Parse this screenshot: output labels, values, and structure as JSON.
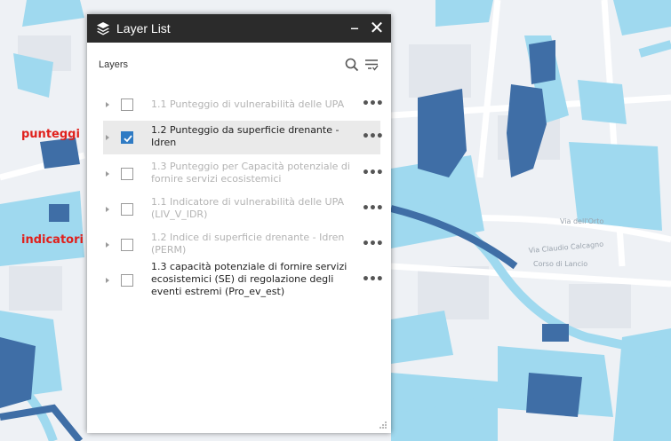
{
  "panel": {
    "title": "Layer List",
    "minimize_label": "–",
    "close_label": "✕",
    "layers_heading": "Layers"
  },
  "layers": [
    {
      "label": "1.1 Punteggio di vulnerabilità delle UPA",
      "checked": false,
      "visible": false
    },
    {
      "label": "1.2 Punteggio da superficie drenante - Idren",
      "checked": true,
      "visible": true
    },
    {
      "label": "1.3 Punteggio per Capacità potenziale di fornire servizi ecosistemici",
      "checked": false,
      "visible": false
    },
    {
      "label": "1.1 Indicatore di vulnerabilità delle UPA (LIV_V_IDR)",
      "checked": false,
      "visible": false
    },
    {
      "label": "1.2 Indice di superficie drenante - Idren (PERM)",
      "checked": false,
      "visible": false
    },
    {
      "label": "1.3 capacità potenziale di fornire servizi ecosistemici (SE) di regolazione degli eventi estremi (Pro_ev_est)",
      "checked": false,
      "visible": true
    }
  ],
  "more_label": "•••",
  "annotations": {
    "group1": "punteggi",
    "group2": "indicatori"
  },
  "colors": {
    "accent": "#2f7bc4",
    "annotation": "#e0201c",
    "header": "#2b2b2b",
    "map_light_blue": "#9fd9ef",
    "map_dark_blue": "#3f6ea6"
  }
}
